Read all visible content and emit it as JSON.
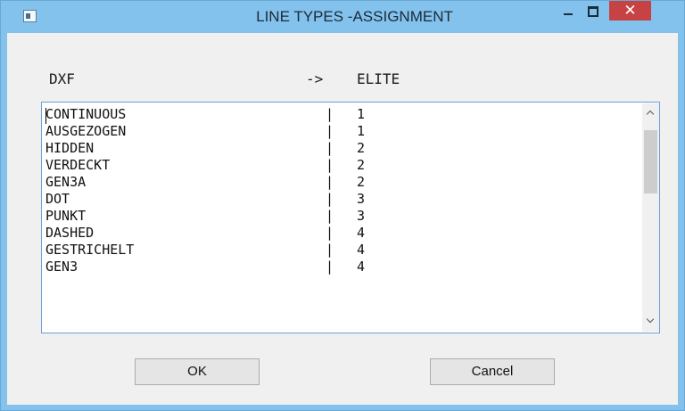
{
  "window": {
    "title": "LINE TYPES -ASSIGNMENT",
    "close_glyph": "✕"
  },
  "header": {
    "dxf": "DXF",
    "arrow": "->",
    "elite": "ELITE"
  },
  "list": {
    "separator": "|",
    "rows": [
      {
        "name": "CONTINUOUS",
        "value": "1"
      },
      {
        "name": "AUSGEZOGEN",
        "value": "1"
      },
      {
        "name": "HIDDEN",
        "value": "2"
      },
      {
        "name": "VERDECKT",
        "value": "2"
      },
      {
        "name": "GEN3A",
        "value": "2"
      },
      {
        "name": "DOT",
        "value": "3"
      },
      {
        "name": "PUNKT",
        "value": "3"
      },
      {
        "name": "DASHED",
        "value": "4"
      },
      {
        "name": "GESTRICHELT",
        "value": "4"
      },
      {
        "name": "GEN3",
        "value": "4"
      }
    ]
  },
  "buttons": {
    "ok": "OK",
    "cancel": "Cancel"
  },
  "icons": {
    "app": "app-window-icon",
    "minimize": "minimize-icon",
    "maximize": "maximize-icon",
    "close": "close-icon",
    "scroll_up": "chevron-up-icon",
    "scroll_down": "chevron-down-icon"
  },
  "colors": {
    "titlebar": "#82c2ed",
    "close_button": "#c74343",
    "list_border": "#6a9fd8"
  }
}
